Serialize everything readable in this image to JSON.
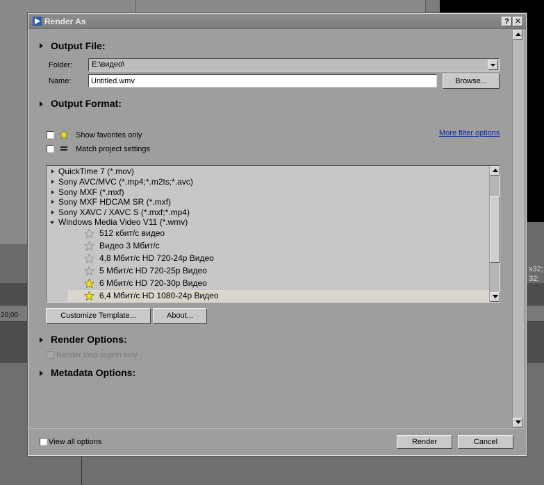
{
  "background": {
    "ruler_time": "20;00",
    "right_text_1": "x32;",
    "right_text_2": "32;"
  },
  "dialog": {
    "title": "Render As",
    "help_label": "?",
    "close_label": "✕"
  },
  "output_file": {
    "heading": "Output File:",
    "folder_label": "Folder:",
    "folder_value": "E:\\видео\\",
    "name_label": "Name:",
    "name_value": "Untitled.wmv",
    "browse_label": "Browse..."
  },
  "output_format": {
    "heading": "Output Format:",
    "show_favorites_label": "Show favorites only",
    "match_project_label": "Match project settings",
    "more_filter_label": "More filter options"
  },
  "format_list": {
    "groups": [
      {
        "label": "QuickTime 7 (*.mov)",
        "expanded": false
      },
      {
        "label": "Sony AVC/MVC (*.mp4;*.m2ts;*.avc)",
        "expanded": false
      },
      {
        "label": "Sony MXF (*.mxf)",
        "expanded": false
      },
      {
        "label": "Sony MXF HDCAM SR (*.mxf)",
        "expanded": false
      },
      {
        "label": "Sony XAVC / XAVC S (*.mxf;*.mp4)",
        "expanded": false
      },
      {
        "label": "Windows Media Video V11 (*.wmv)",
        "expanded": true
      }
    ],
    "templates": [
      {
        "label": "512 кбит/с видео",
        "favorite": false
      },
      {
        "label": "Видео 3 Мбит/с",
        "favorite": false
      },
      {
        "label": "4,8 Мбит/с HD 720-24p Видео",
        "favorite": false
      },
      {
        "label": "5 Мбит/с HD 720-25p Видео",
        "favorite": false
      },
      {
        "label": "6 Мбит/с HD 720-30p Видео",
        "favorite": true
      },
      {
        "label": "6,4 Мбит/с HD 1080-24p Видео",
        "favorite": true,
        "selected": true
      }
    ]
  },
  "template_buttons": {
    "customize_label": "Customize Template...",
    "about_label": "About..."
  },
  "render_options": {
    "heading": "Render Options:",
    "loop_region_label": "Render loop region only"
  },
  "metadata_options": {
    "heading": "Metadata Options:"
  },
  "footer": {
    "view_all_label": "View all options",
    "render_label": "Render",
    "cancel_label": "Cancel"
  },
  "colors": {
    "star_favorite": "#f3e219",
    "star_empty": "#c4c4c4",
    "link": "#0a2aa8",
    "selection": "#dad6cd"
  }
}
